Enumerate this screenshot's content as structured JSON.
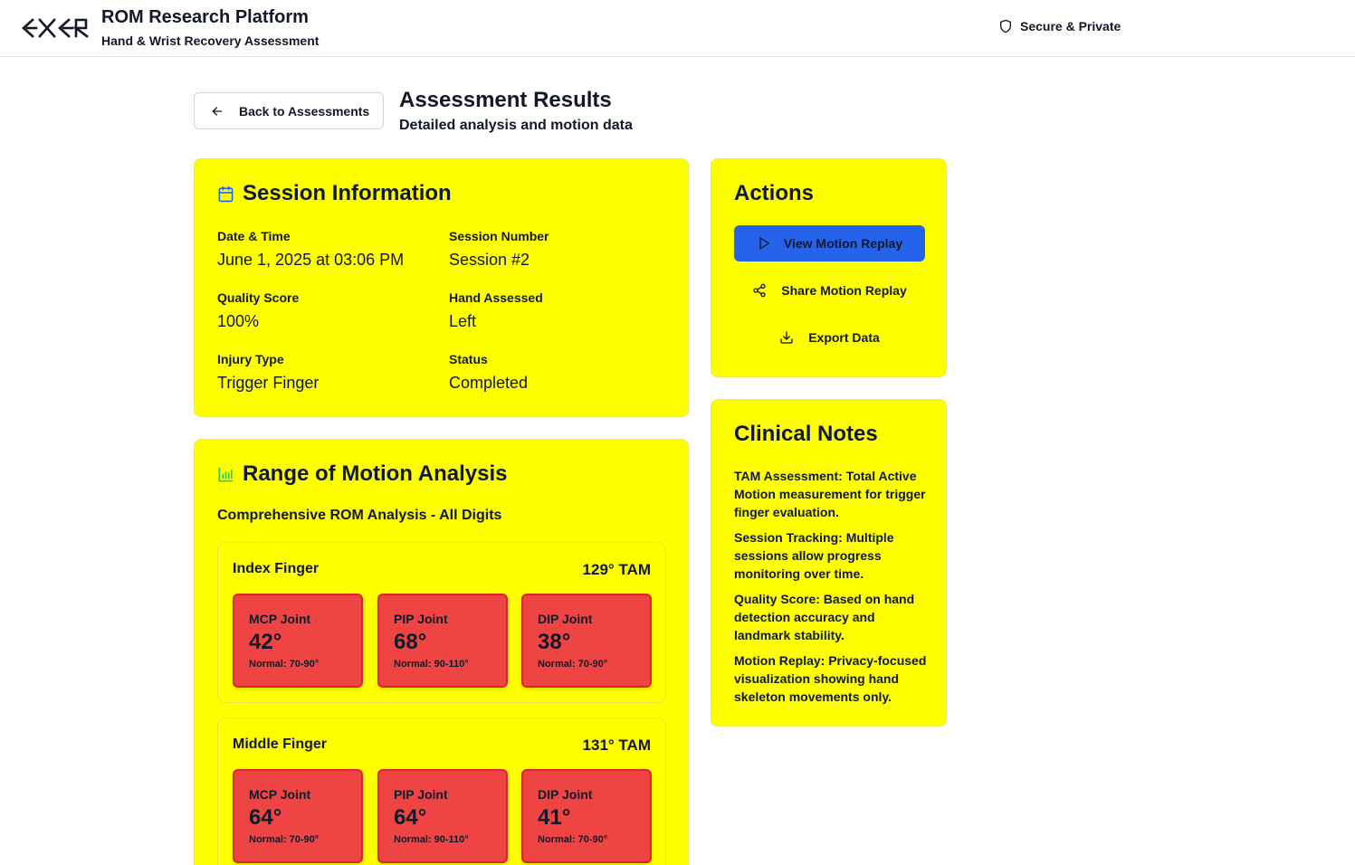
{
  "header": {
    "app_title": "ROM Research Platform",
    "app_subtitle": "Hand & Wrist Recovery Assessment",
    "secure_label": "Secure & Private",
    "logo_text": "EXER"
  },
  "page": {
    "back_label": "Back to Assessments",
    "title": "Assessment Results",
    "subtitle": "Detailed analysis and motion data"
  },
  "session": {
    "title": "Session Information",
    "fields": [
      {
        "label": "Date & Time",
        "value": "June 1, 2025 at 03:06 PM"
      },
      {
        "label": "Session Number",
        "value": "Session #2"
      },
      {
        "label": "Quality Score",
        "value": "100%"
      },
      {
        "label": "Hand Assessed",
        "value": "Left"
      },
      {
        "label": "Injury Type",
        "value": "Trigger Finger"
      },
      {
        "label": "Status",
        "value": "Completed"
      }
    ]
  },
  "rom": {
    "title": "Range of Motion Analysis",
    "subtitle": "Comprehensive ROM Analysis - All Digits",
    "fingers": [
      {
        "name": "Index Finger",
        "tam": "129° TAM",
        "joints": [
          {
            "name": "MCP Joint",
            "degrees": "42°",
            "normal": "Normal: 70-90°"
          },
          {
            "name": "PIP Joint",
            "degrees": "68°",
            "normal": "Normal: 90-110°"
          },
          {
            "name": "DIP Joint",
            "degrees": "38°",
            "normal": "Normal: 70-90°"
          }
        ]
      },
      {
        "name": "Middle Finger",
        "tam": "131° TAM",
        "joints": [
          {
            "name": "MCP Joint",
            "degrees": "64°",
            "normal": "Normal: 70-90°"
          },
          {
            "name": "PIP Joint",
            "degrees": "64°",
            "normal": "Normal: 90-110°"
          },
          {
            "name": "DIP Joint",
            "degrees": "41°",
            "normal": "Normal: 70-90°"
          }
        ]
      }
    ]
  },
  "actions": {
    "title": "Actions",
    "view_replay": "View Motion Replay",
    "share_replay": "Share Motion Replay",
    "export": "Export Data"
  },
  "notes": {
    "title": "Clinical Notes",
    "items": [
      "TAM Assessment: Total Active Motion measurement for trigger finger evaluation.",
      "Session Tracking: Multiple sessions allow progress monitoring over time.",
      "Quality Score: Based on hand detection accuracy and landmark stability.",
      "Motion Replay: Privacy-focused visualization showing hand skeleton movements only."
    ]
  },
  "colors": {
    "card_bg": "#ffff00",
    "joint_bad": "#ef4444",
    "primary": "#2563eb"
  },
  "icons": [
    "exer-logo",
    "shield-icon",
    "arrow-left-icon",
    "calendar-icon",
    "bar-chart-icon",
    "play-icon",
    "share-icon",
    "download-icon"
  ]
}
